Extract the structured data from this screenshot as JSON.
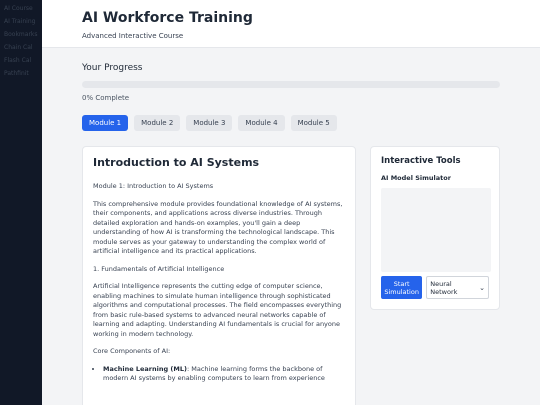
{
  "sidebar": {
    "items": [
      {
        "label": "AI Course"
      },
      {
        "label": "AI Training"
      },
      {
        "label": "Bookmarks"
      },
      {
        "label": "Chain Cal"
      },
      {
        "label": "Flash Cal"
      },
      {
        "label": "Pathfinit"
      }
    ]
  },
  "header": {
    "title": "AI Workforce Training",
    "subtitle": "Advanced Interactive Course"
  },
  "progress": {
    "title": "Your Progress",
    "percent": 0,
    "text": "0% Complete"
  },
  "modules": [
    {
      "label": "Module 1",
      "active": true
    },
    {
      "label": "Module 2",
      "active": false
    },
    {
      "label": "Module 3",
      "active": false
    },
    {
      "label": "Module 4",
      "active": false
    },
    {
      "label": "Module 5",
      "active": false
    }
  ],
  "content": {
    "title": "Introduction to AI Systems",
    "module_heading": "Module 1: Introduction to AI Systems",
    "intro": "This comprehensive module provides foundational knowledge of AI systems, their components, and applications across diverse industries. Through detailed exploration and hands-on examples, you'll gain a deep understanding of how AI is transforming the technological landscape. This module serves as your gateway to understanding the complex world of artificial intelligence and its practical applications.",
    "section_heading": "1. Fundamentals of Artificial Intelligence",
    "section_text": "Artificial Intelligence represents the cutting edge of computer science, enabling machines to simulate human intelligence through sophisticated algorithms and computational processes. The field encompasses everything from basic rule-based systems to advanced neural networks capable of learning and adapting. Understanding AI fundamentals is crucial for anyone working in modern technology.",
    "components_heading": "Core Components of AI:",
    "components": [
      {
        "name": "Machine Learning (ML)",
        "text": ": Machine learning forms the backbone of modern AI systems by enabling computers to learn from experience"
      }
    ]
  },
  "tools": {
    "title": "Interactive Tools",
    "simulator_label": "AI Model Simulator",
    "start_button": "Start Simulation",
    "network_select": "Neural Network"
  },
  "colors": {
    "accent": "#2563eb",
    "sidebar_bg": "#111827",
    "page_bg": "#f3f4f6"
  }
}
